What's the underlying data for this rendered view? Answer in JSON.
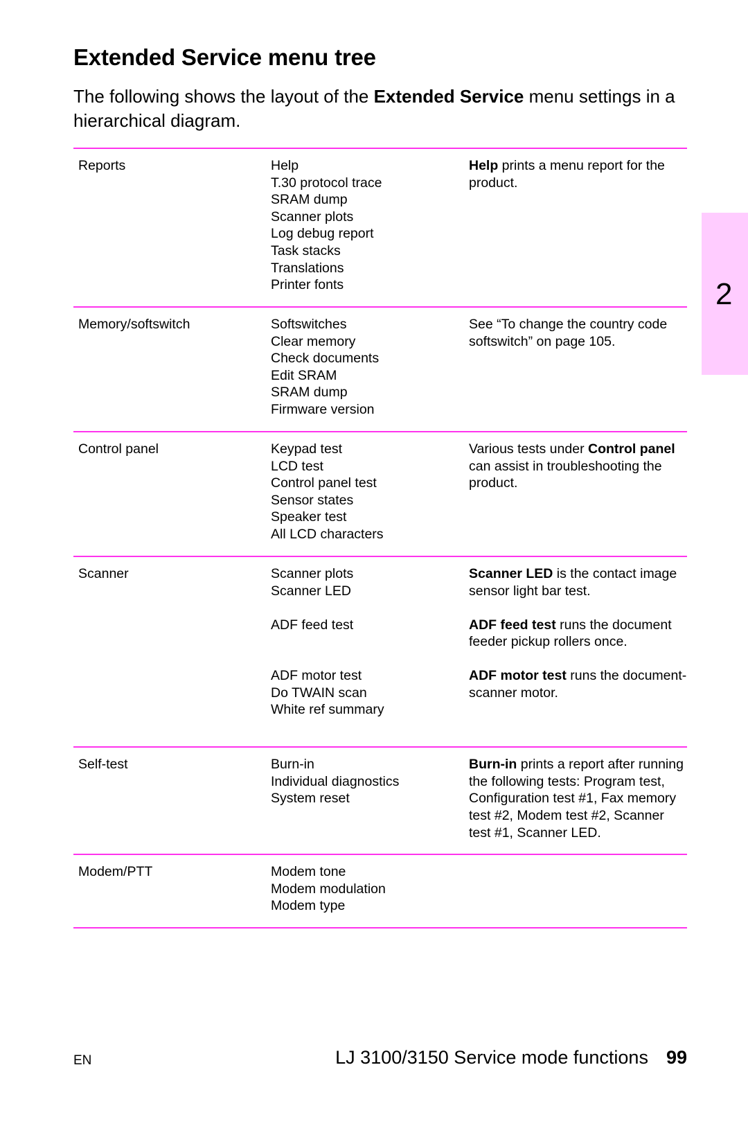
{
  "heading": "Extended Service menu tree",
  "intro": {
    "before": "The following shows the layout of the ",
    "bold": "Extended Service",
    "after": " menu settings in a hierarchical diagram."
  },
  "side_tab": {
    "label": "2",
    "color": "#ffccff"
  },
  "rule_color": "#ff33ee",
  "rows": [
    {
      "menu": "Reports",
      "groups": [
        {
          "items": [
            "Help",
            "T.30 protocol trace",
            "SRAM dump",
            "Scanner plots",
            "Log debug report",
            "Task stacks",
            "Translations",
            "Printer fonts"
          ],
          "desc_bold": "Help",
          "desc": " prints a menu report for the product."
        }
      ]
    },
    {
      "menu": "Memory/softswitch",
      "groups": [
        {
          "items": [
            "Softswitches",
            "Clear memory",
            "Check documents",
            "Edit SRAM",
            "SRAM dump",
            "Firmware version"
          ],
          "desc_bold": "",
          "desc": "See “To change the country code softswitch” on page 105."
        }
      ]
    },
    {
      "menu": "Control panel",
      "groups": [
        {
          "items": [
            "Keypad test",
            "LCD test",
            "Control panel test",
            "Sensor states",
            "Speaker test",
            "All LCD characters"
          ],
          "desc_pre": "Various tests under ",
          "desc_bold": "Control panel",
          "desc": " can assist in troubleshooting the product."
        }
      ]
    },
    {
      "menu": "Scanner",
      "groups": [
        {
          "items": [
            "Scanner plots",
            "Scanner LED"
          ],
          "desc_bold": "Scanner LED",
          "desc": " is the contact image sensor light bar test."
        },
        {
          "items": [
            "ADF feed test"
          ],
          "desc_bold": "ADF feed test",
          "desc": " runs the document feeder pickup rollers once."
        },
        {
          "items": [
            "ADF motor test",
            "Do TWAIN scan",
            "White ref summary"
          ],
          "desc_bold": "ADF motor test",
          "desc": " runs the document-scanner motor."
        }
      ]
    },
    {
      "menu": "Self-test",
      "groups": [
        {
          "items": [
            "Burn-in",
            "Individual diagnostics",
            "System reset"
          ],
          "desc_bold": "Burn-in",
          "desc": " prints a report after running the following tests: Program test, Configuration test #1, Fax memory test #2, Modem test #2, Scanner test #1, Scanner LED."
        }
      ]
    },
    {
      "menu": "Modem/PTT",
      "groups": [
        {
          "items": [
            "Modem tone",
            "Modem modulation",
            "Modem type"
          ],
          "desc_bold": "",
          "desc": ""
        }
      ]
    }
  ],
  "footer": {
    "lang": "EN",
    "title": "LJ 3100/3150 Service mode functions",
    "page": "99"
  }
}
